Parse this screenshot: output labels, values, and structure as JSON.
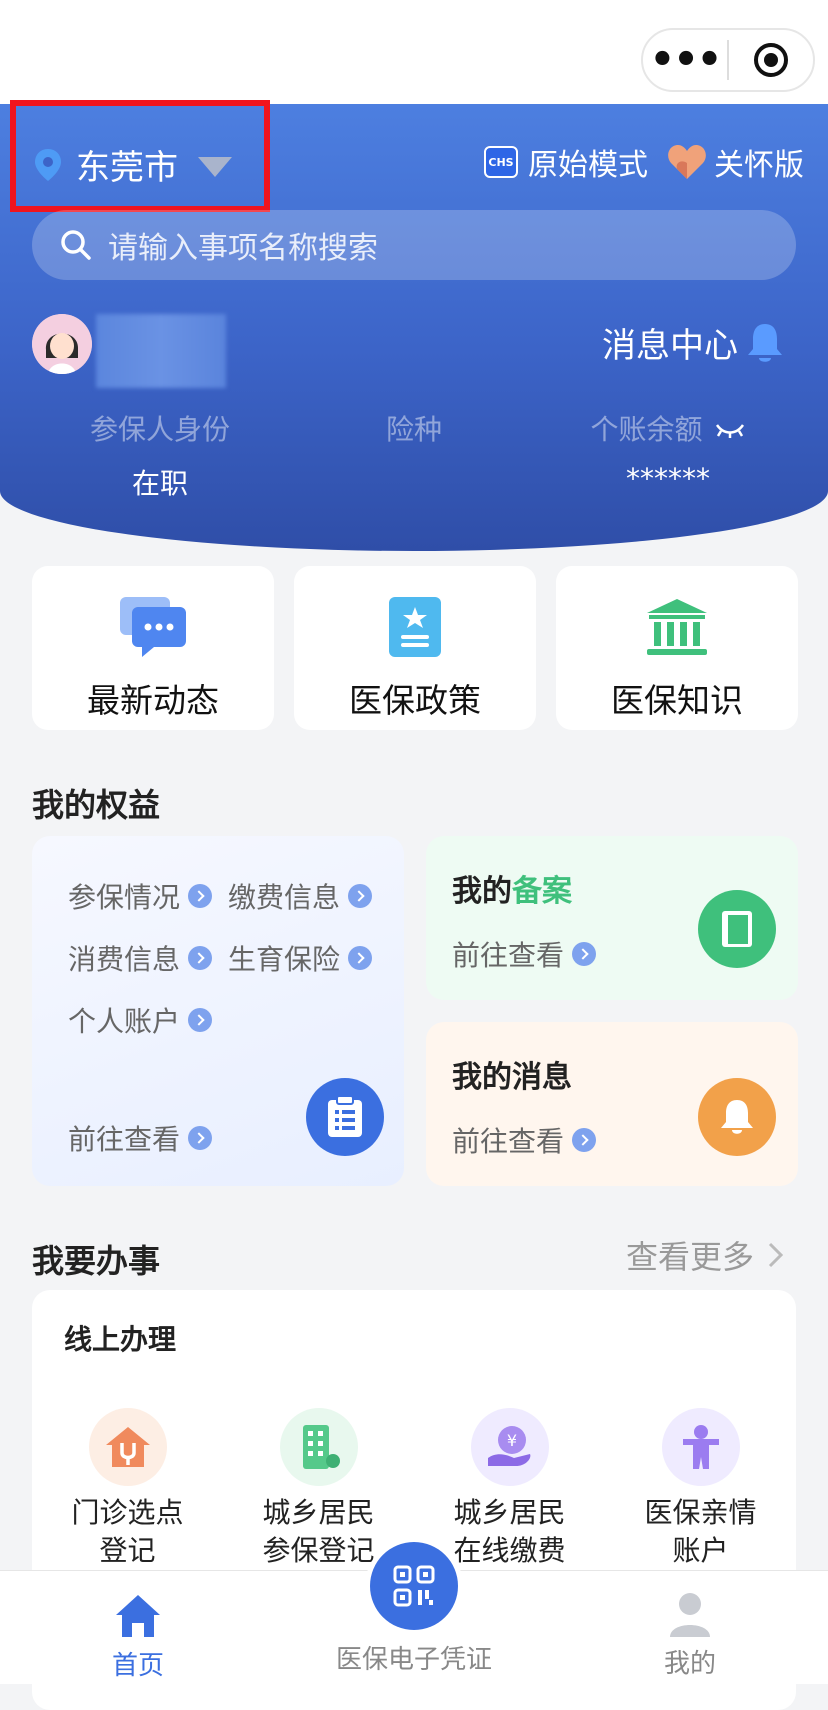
{
  "top_bar": {
    "menu_label": "•••"
  },
  "header": {
    "city": "东莞市",
    "original_mode": "原始模式",
    "chs_badge": "CHS",
    "care_mode": "关怀版",
    "search_placeholder": "请输入事项名称搜索",
    "message_center": "消息中心",
    "stats": [
      {
        "label": "参保人身份",
        "value": "在职"
      },
      {
        "label": "险种",
        "value": ""
      },
      {
        "label": "个账余额",
        "value": "******"
      }
    ]
  },
  "quick_links": [
    {
      "label": "最新动态",
      "icon": "chat-bubbles-icon"
    },
    {
      "label": "医保政策",
      "icon": "policy-star-icon"
    },
    {
      "label": "医保知识",
      "icon": "bank-building-icon"
    }
  ],
  "rights": {
    "title": "我的权益",
    "links": [
      "参保情况",
      "缴费信息",
      "消费信息",
      "生育保险",
      "个人账户"
    ],
    "go_view": "前往查看",
    "filing": {
      "title_prefix": "我的",
      "title_highlight": "备案",
      "go_view": "前往查看"
    },
    "messages": {
      "title": "我的消息",
      "go_view": "前往查看"
    }
  },
  "services": {
    "title": "我要办事",
    "more": "查看更多",
    "online_title": "线上办理",
    "items": [
      {
        "line1": "门诊选点",
        "line2": "登记"
      },
      {
        "line1": "城乡居民",
        "line2": "参保登记"
      },
      {
        "line1": "城乡居民",
        "line2": "在线缴费"
      },
      {
        "line1": "医保亲情",
        "line2": "账户"
      }
    ]
  },
  "bottom_nav": {
    "home": "首页",
    "voucher": "医保电子凭证",
    "mine": "我的"
  },
  "colors": {
    "primary": "#3b6fe0",
    "highlight_box": "#f0141e",
    "green": "#3fc07c",
    "orange": "#f2a14a"
  }
}
